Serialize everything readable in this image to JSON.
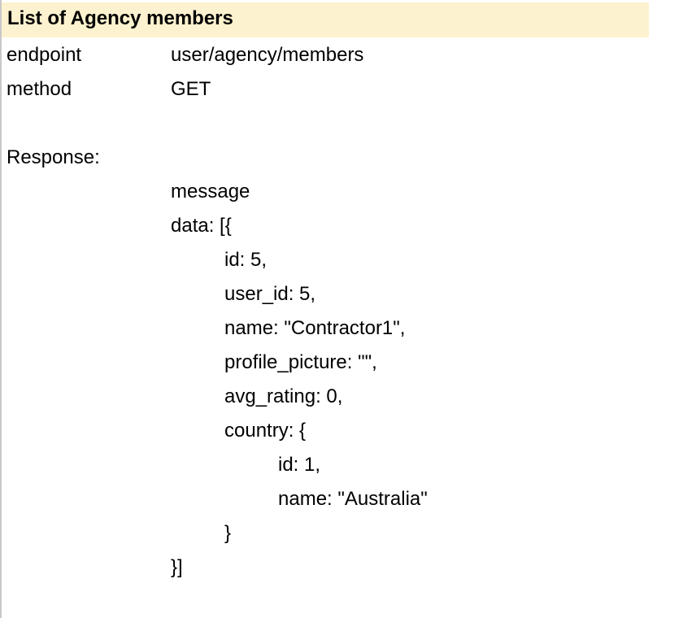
{
  "header": {
    "title": "List of Agency members"
  },
  "rows": {
    "endpoint_label": "endpoint",
    "endpoint_value": "user/agency/members",
    "method_label": "method",
    "method_value": "GET",
    "response_label": "Response:"
  },
  "response": {
    "lines": [
      "message",
      "data: [{",
      "id: 5,",
      "user_id: 5,",
      "name: \"Contractor1\",",
      "profile_picture: \"\",",
      "avg_rating: 0,",
      "country: {",
      "id: 1,",
      "name: \"Australia\"",
      "}",
      "}]"
    ]
  },
  "colors": {
    "header_bg": "#fdf2cf",
    "grid_border": "#c8c8c8"
  }
}
